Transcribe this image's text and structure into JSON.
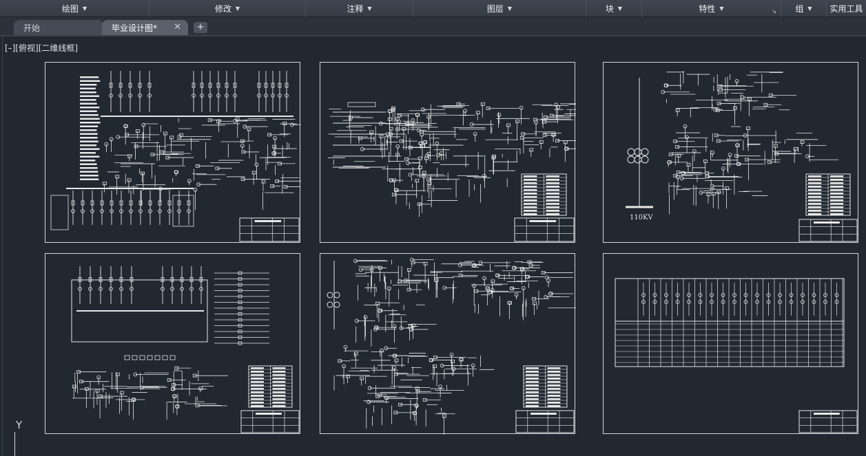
{
  "ribbon": {
    "panels": [
      {
        "label": "绘图",
        "has_arrow": true
      },
      {
        "label": "修改",
        "has_arrow": true
      },
      {
        "label": "注释",
        "has_arrow": true
      },
      {
        "label": "图层",
        "has_arrow": true
      },
      {
        "label": "块",
        "has_arrow": true
      },
      {
        "label": "特性",
        "has_arrow": true,
        "has_launcher": true
      },
      {
        "label": "组",
        "has_arrow": true
      },
      {
        "label": "实用工具",
        "has_arrow": false
      }
    ],
    "arrow_glyph": "▼",
    "launcher_glyph": "↘"
  },
  "tabs": {
    "start_label": "开始",
    "drawing_label": "毕业设计图*",
    "close_glyph": "✕",
    "add_glyph": "+"
  },
  "viewport": {
    "label": "[–][俯视][二维线框]",
    "ucs_y": "Y"
  },
  "sheets": [
    {
      "id": "sheet-1",
      "title_text": ""
    },
    {
      "id": "sheet-2",
      "title_text": ""
    },
    {
      "id": "sheet-3",
      "title_text": "110KV"
    },
    {
      "id": "sheet-4",
      "title_text": ""
    },
    {
      "id": "sheet-5",
      "title_text": ""
    },
    {
      "id": "sheet-6",
      "title_text": ""
    }
  ],
  "colors": {
    "background": "#212830",
    "linework": "#e8e8e8",
    "ribbon": "#3a414b"
  }
}
